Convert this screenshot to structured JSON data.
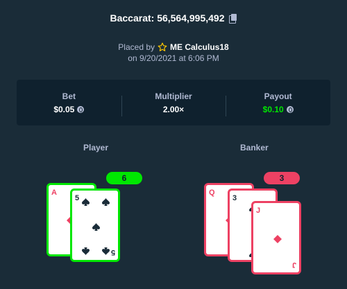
{
  "header": {
    "title": "Baccarat: 56,564,995,492"
  },
  "meta": {
    "placed_by": "Placed by",
    "user": "ME Calculus18",
    "date": "on 9/20/2021 at 6:06 PM"
  },
  "stats": {
    "bet": {
      "label": "Bet",
      "value": "$0.05"
    },
    "multiplier": {
      "label": "Multiplier",
      "value": "2.00×"
    },
    "payout": {
      "label": "Payout",
      "value": "$0.10"
    }
  },
  "player": {
    "label": "Player",
    "score": "6",
    "cards": [
      {
        "rank": "A",
        "suit": "diamond"
      },
      {
        "rank": "5",
        "suit": "spade"
      }
    ]
  },
  "banker": {
    "label": "Banker",
    "score": "3",
    "cards": [
      {
        "rank": "Q",
        "suit": "diamond"
      },
      {
        "rank": "3",
        "suit": "spade"
      },
      {
        "rank": "J",
        "suit": "diamond"
      }
    ]
  },
  "colors": {
    "background": "#1a2c38",
    "panel": "#0f212e",
    "win": "#00e701",
    "lose": "#ed4163",
    "muted": "#b1bad3"
  }
}
